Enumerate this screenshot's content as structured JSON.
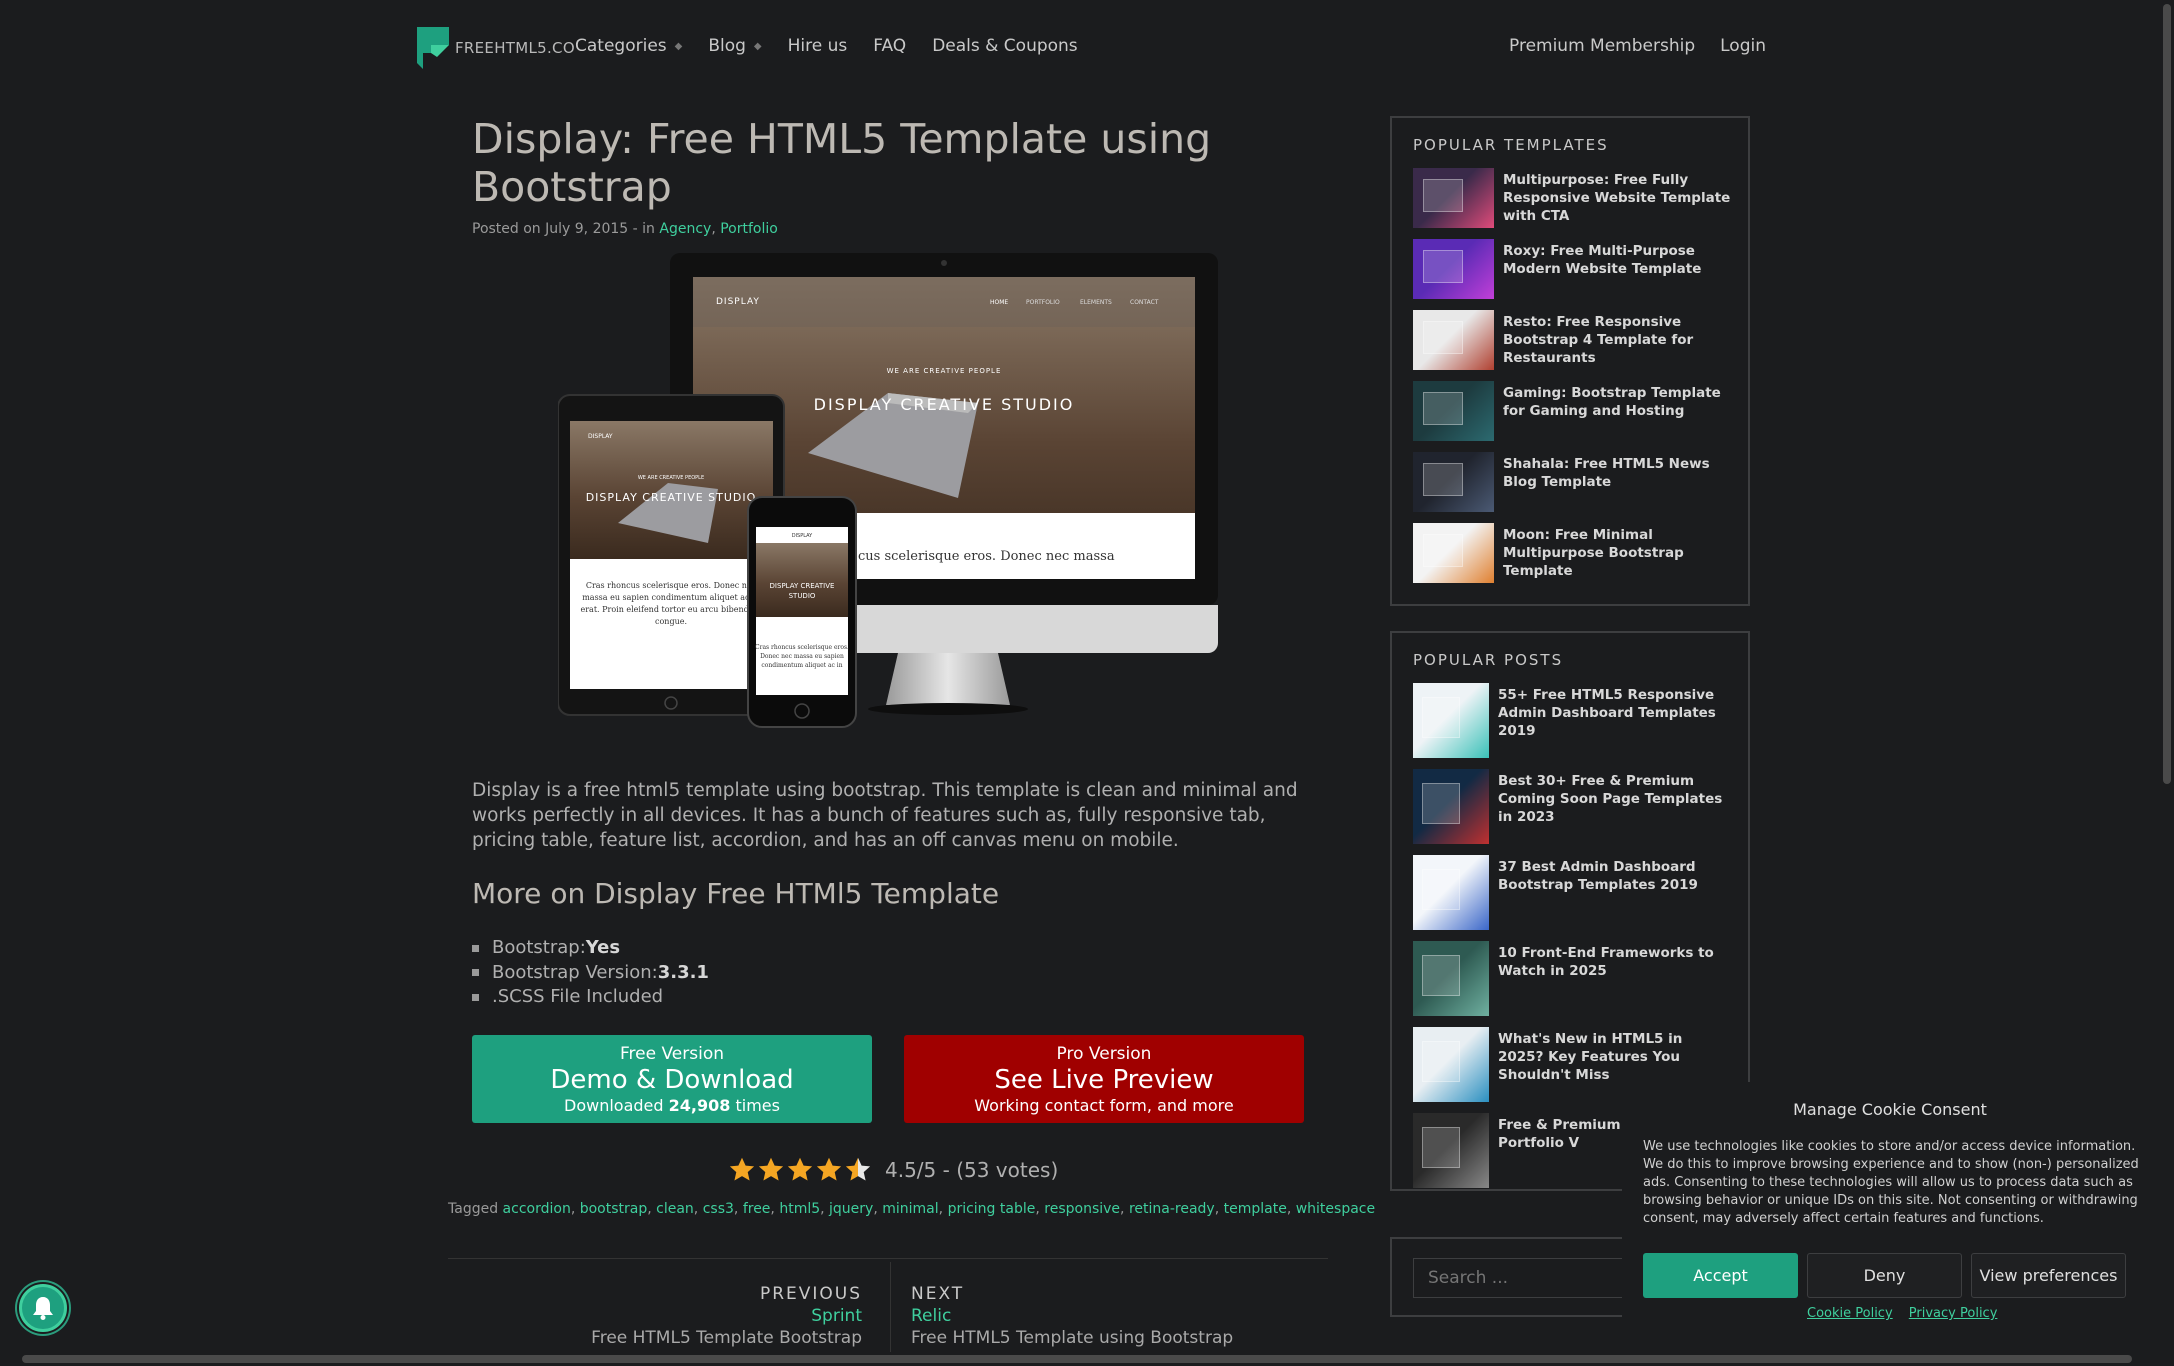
{
  "header": {
    "logo_text": "FREEHTML5.CO",
    "nav": [
      "Categories",
      "Blog",
      "Hire us",
      "FAQ",
      "Deals & Coupons"
    ],
    "nav_right": [
      "Premium Membership",
      "Login"
    ]
  },
  "article": {
    "title": "Display: Free HTML5 Template using Bootstrap",
    "meta_prefix": "Posted on July 9, 2015 - in",
    "meta_cat1": "Agency",
    "meta_cat2": "Portfolio",
    "hero": {
      "brand": "DISPLAY",
      "tagline": "WE ARE CREATIVE PEOPLE",
      "headline": "DISPLAY CREATIVE STUDIO",
      "body_snippet": "cus scelerisque eros. Donec nec massa"
    },
    "description": "Display is a free html5 template using bootstrap. This template is clean and minimal and works perfectly in all devices. It has a bunch of features such as, fully responsive tab, pricing table, feature list, accordion, and has an off canvas menu on mobile.",
    "subheading": "More on Display Free HTMl5 Template",
    "specs": [
      {
        "label": "Bootstrap: ",
        "value": "Yes"
      },
      {
        "label": "Bootstrap Version: ",
        "value": "3.3.1"
      },
      {
        "label": ".SCSS File Included",
        "value": ""
      }
    ],
    "free_btn": {
      "l1": "Free Version",
      "l2": "Demo & Download",
      "l3_prefix": "Downloaded ",
      "l3_count": "24,908",
      "l3_suffix": " times"
    },
    "pro_btn": {
      "l1": "Pro Version",
      "l2": "See Live Preview",
      "l3": "Working contact form, and more"
    },
    "rating": {
      "value": 4.5,
      "text": "4.5/5 - (53 votes)",
      "color": "#f5a623"
    },
    "tags_prefix": "Tagged ",
    "tags": [
      "accordion",
      "bootstrap",
      "clean",
      "css3",
      "free",
      "html5",
      "jquery",
      "minimal",
      "pricing table",
      "responsive",
      "retina-ready",
      "template",
      "whitespace"
    ],
    "prev": {
      "label": "PREVIOUS",
      "link": "Sprint",
      "sub": "Free HTML5 Template Bootstrap"
    },
    "next": {
      "label": "NEXT",
      "link": "Relic",
      "sub": "Free HTML5 Template using Bootstrap"
    }
  },
  "sidebar": {
    "popular_templates_title": "POPULAR TEMPLATES",
    "popular_templates": [
      "Multipurpose: Free Fully Responsive Website Template with CTA",
      "Roxy: Free Multi-Purpose Modern Website Template",
      "Resto: Free Responsive Bootstrap 4 Template for Restaurants",
      "Gaming: Bootstrap Template for Gaming and Hosting",
      "Shahala: Free HTML5 News Blog Template",
      "Moon: Free Minimal Multipurpose Bootstrap Template"
    ],
    "popular_posts_title": "POPULAR POSTS",
    "popular_posts": [
      "55+ Free HTML5 Responsive Admin Dashboard Templates 2019",
      "Best 30+ Free & Premium Coming Soon Page Templates in 2023",
      "37 Best Admin Dashboard Bootstrap Templates 2019",
      "10 Front-End Frameworks to Watch in 2025",
      "What's New in HTML5 in 2025? Key Features You Shouldn't Miss",
      "Free & Premium Ph Creative Portfolio V"
    ],
    "search_placeholder": "Search ..."
  },
  "cookie": {
    "title": "Manage Cookie Consent",
    "body": "We use technologies like cookies to store and/or access device information. We do this to improve browsing experience and to show (non-) personalized ads. Consenting to these technologies will allow us to process data such as browsing behavior or unique IDs on this site. Not consenting or withdrawing consent, may adversely affect certain features and functions.",
    "accept": "Accept",
    "deny": "Deny",
    "view": "View preferences",
    "cookie_policy": "Cookie Policy",
    "privacy_policy": "Privacy Policy"
  },
  "colors": {
    "accent": "#1ea07f",
    "link": "#3fcf9e",
    "pro": "#a00000",
    "background": "#1b1c1e"
  }
}
